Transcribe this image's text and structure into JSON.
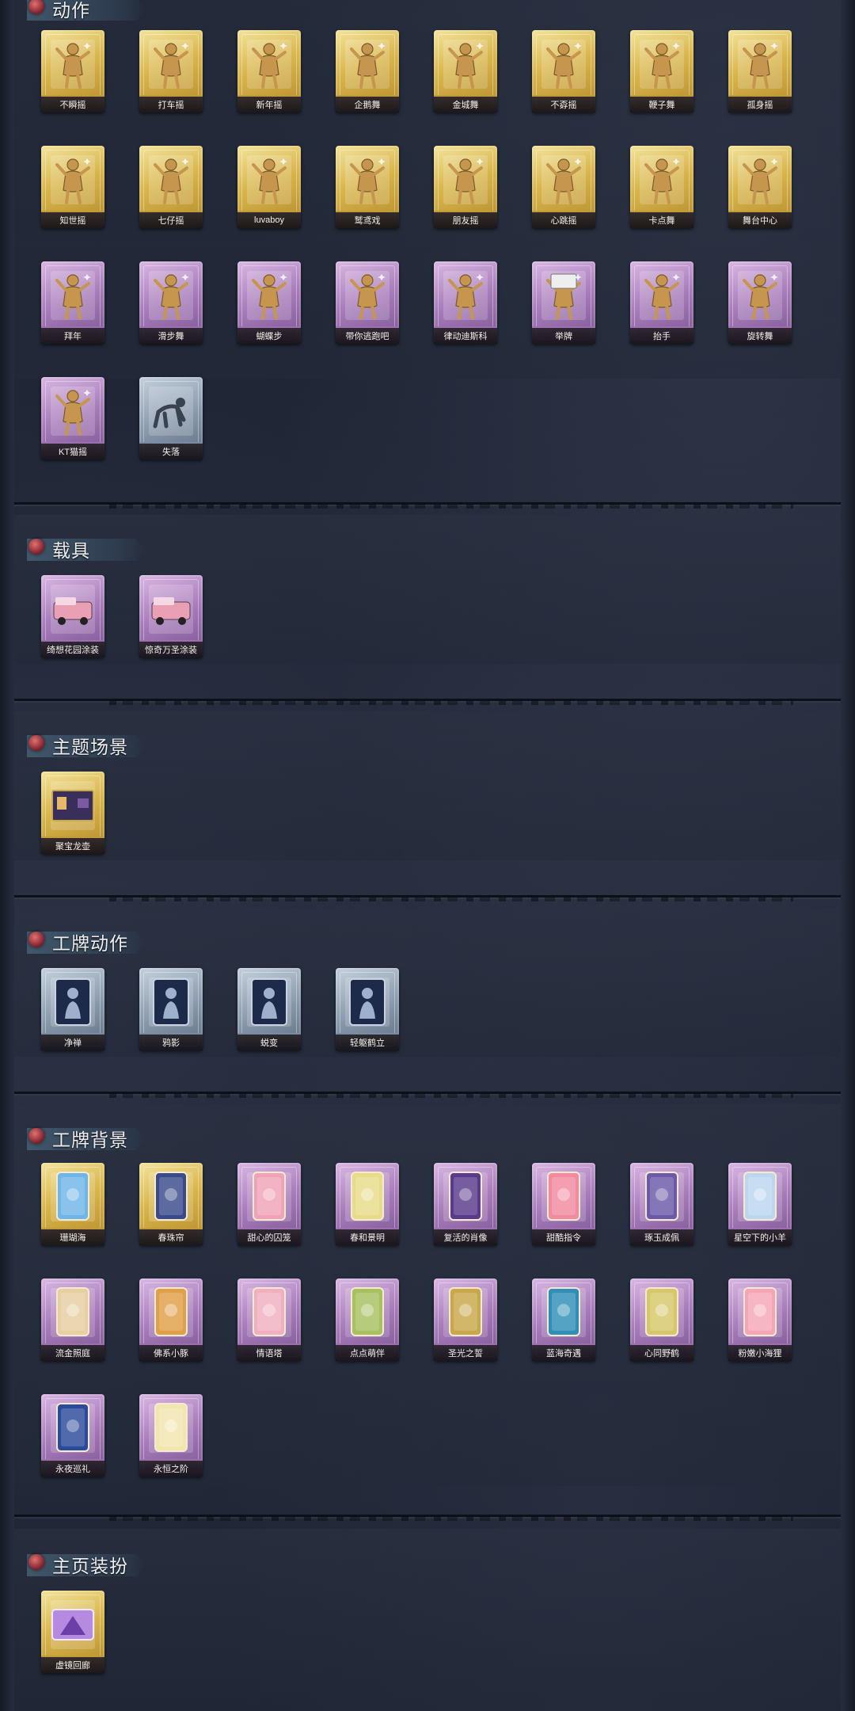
{
  "sections": [
    {
      "title": "动作",
      "items": [
        {
          "label": "不瞬摇",
          "rarity": "gold",
          "icon": "figure-dance-icon"
        },
        {
          "label": "打车摇",
          "rarity": "gold",
          "icon": "figure-dance-icon"
        },
        {
          "label": "新年摇",
          "rarity": "gold",
          "icon": "figure-dance-icon"
        },
        {
          "label": "企鹅舞",
          "rarity": "gold",
          "icon": "figure-dance-icon"
        },
        {
          "label": "金城舞",
          "rarity": "gold",
          "icon": "figure-dance-icon"
        },
        {
          "label": "不孬摇",
          "rarity": "gold",
          "icon": "figure-dance-icon"
        },
        {
          "label": "鞭子舞",
          "rarity": "gold",
          "icon": "figure-dance-icon"
        },
        {
          "label": "孤身摇",
          "rarity": "gold",
          "icon": "figure-dance-icon"
        },
        {
          "label": "知世摇",
          "rarity": "gold",
          "icon": "figure-dance-icon"
        },
        {
          "label": "七仔摇",
          "rarity": "gold",
          "icon": "figure-dance-icon"
        },
        {
          "label": "luvaboy",
          "rarity": "gold",
          "icon": "figure-dance-icon"
        },
        {
          "label": "鹫鸢戏",
          "rarity": "gold",
          "icon": "figure-dance-icon"
        },
        {
          "label": "朋友摇",
          "rarity": "gold",
          "icon": "figure-dance-icon"
        },
        {
          "label": "心跳摇",
          "rarity": "gold",
          "icon": "figure-dance-icon"
        },
        {
          "label": "卡点舞",
          "rarity": "gold",
          "icon": "figure-dance-icon"
        },
        {
          "label": "舞台中心",
          "rarity": "gold",
          "icon": "figure-dance-icon"
        },
        {
          "label": "拜年",
          "rarity": "purple",
          "icon": "figure-dance-icon"
        },
        {
          "label": "滑步舞",
          "rarity": "purple",
          "icon": "figure-dance-icon"
        },
        {
          "label": "蝴蝶步",
          "rarity": "purple",
          "icon": "figure-dance-icon"
        },
        {
          "label": "带你逃跑吧",
          "rarity": "purple",
          "icon": "figure-dance-icon"
        },
        {
          "label": "律动迪斯科",
          "rarity": "purple",
          "icon": "figure-dance-icon"
        },
        {
          "label": "举牌",
          "rarity": "purple",
          "icon": "figure-sign-icon"
        },
        {
          "label": "抬手",
          "rarity": "purple",
          "icon": "figure-dance-icon"
        },
        {
          "label": "旋转舞",
          "rarity": "purple",
          "icon": "figure-dance-icon"
        },
        {
          "label": "KT猫摇",
          "rarity": "purple",
          "icon": "figure-dance-icon"
        },
        {
          "label": "失落",
          "rarity": "blue",
          "icon": "figure-crawl-icon"
        }
      ]
    },
    {
      "title": "载具",
      "items": [
        {
          "label": "绮想花园涂装",
          "rarity": "purple",
          "icon": "vehicle-icon"
        },
        {
          "label": "惊奇万圣涂装",
          "rarity": "purple",
          "icon": "vehicle-icon"
        }
      ]
    },
    {
      "title": "主题场景",
      "items": [
        {
          "label": "聚宝龙壶",
          "rarity": "gold",
          "icon": "scene-icon"
        }
      ]
    },
    {
      "title": "工牌动作",
      "items": [
        {
          "label": "净禅",
          "rarity": "blue",
          "icon": "badge-figure-icon"
        },
        {
          "label": "鸦影",
          "rarity": "blue",
          "icon": "badge-figure-icon"
        },
        {
          "label": "蜕变",
          "rarity": "blue",
          "icon": "badge-figure-icon"
        },
        {
          "label": "轻躯鹤立",
          "rarity": "blue",
          "icon": "badge-figure-icon"
        }
      ]
    },
    {
      "title": "工牌背景",
      "items": [
        {
          "label": "珊瑚海",
          "rarity": "gold",
          "icon": "badge-card-icon",
          "accent": "#6fb6e8"
        },
        {
          "label": "春珠帘",
          "rarity": "gold",
          "icon": "badge-card-icon",
          "accent": "#3a4a8a"
        },
        {
          "label": "甜心的囚笼",
          "rarity": "purple",
          "icon": "badge-card-icon",
          "accent": "#f0a3b8"
        },
        {
          "label": "春和景明",
          "rarity": "purple",
          "icon": "badge-card-icon",
          "accent": "#e8dc8a"
        },
        {
          "label": "复活的肖像",
          "rarity": "purple",
          "icon": "badge-card-icon",
          "accent": "#5a3a8a"
        },
        {
          "label": "甜酷指令",
          "rarity": "purple",
          "icon": "badge-card-icon",
          "accent": "#f28aa0"
        },
        {
          "label": "琢玉成佩",
          "rarity": "purple",
          "icon": "badge-card-icon",
          "accent": "#6b5aa8"
        },
        {
          "label": "星空下的小羊",
          "rarity": "purple",
          "icon": "badge-card-icon",
          "accent": "#bcd6ee"
        },
        {
          "label": "流金照庭",
          "rarity": "purple",
          "icon": "badge-card-icon",
          "accent": "#e6cfa0"
        },
        {
          "label": "佛系小豚",
          "rarity": "purple",
          "icon": "badge-card-icon",
          "accent": "#e0a048"
        },
        {
          "label": "情语塔",
          "rarity": "purple",
          "icon": "badge-card-icon",
          "accent": "#f0b0c0"
        },
        {
          "label": "点点萌伴",
          "rarity": "purple",
          "icon": "badge-card-icon",
          "accent": "#a8c060"
        },
        {
          "label": "圣光之誓",
          "rarity": "purple",
          "icon": "badge-card-icon",
          "accent": "#c9a84a"
        },
        {
          "label": "蓝海奇遇",
          "rarity": "purple",
          "icon": "badge-card-icon",
          "accent": "#2f8fb8"
        },
        {
          "label": "心同野鹤",
          "rarity": "purple",
          "icon": "badge-card-icon",
          "accent": "#d6c86a"
        },
        {
          "label": "粉嫩小海狸",
          "rarity": "purple",
          "icon": "badge-card-icon",
          "accent": "#f4a6b6"
        },
        {
          "label": "永夜巡礼",
          "rarity": "purple",
          "icon": "badge-card-icon",
          "accent": "#2a4a9a"
        },
        {
          "label": "永恒之阶",
          "rarity": "purple",
          "icon": "badge-card-icon",
          "accent": "#f2e6b0"
        }
      ]
    },
    {
      "title": "主页装扮",
      "items": [
        {
          "label": "虚镜回廊",
          "rarity": "gold",
          "icon": "homepage-icon"
        }
      ]
    }
  ]
}
